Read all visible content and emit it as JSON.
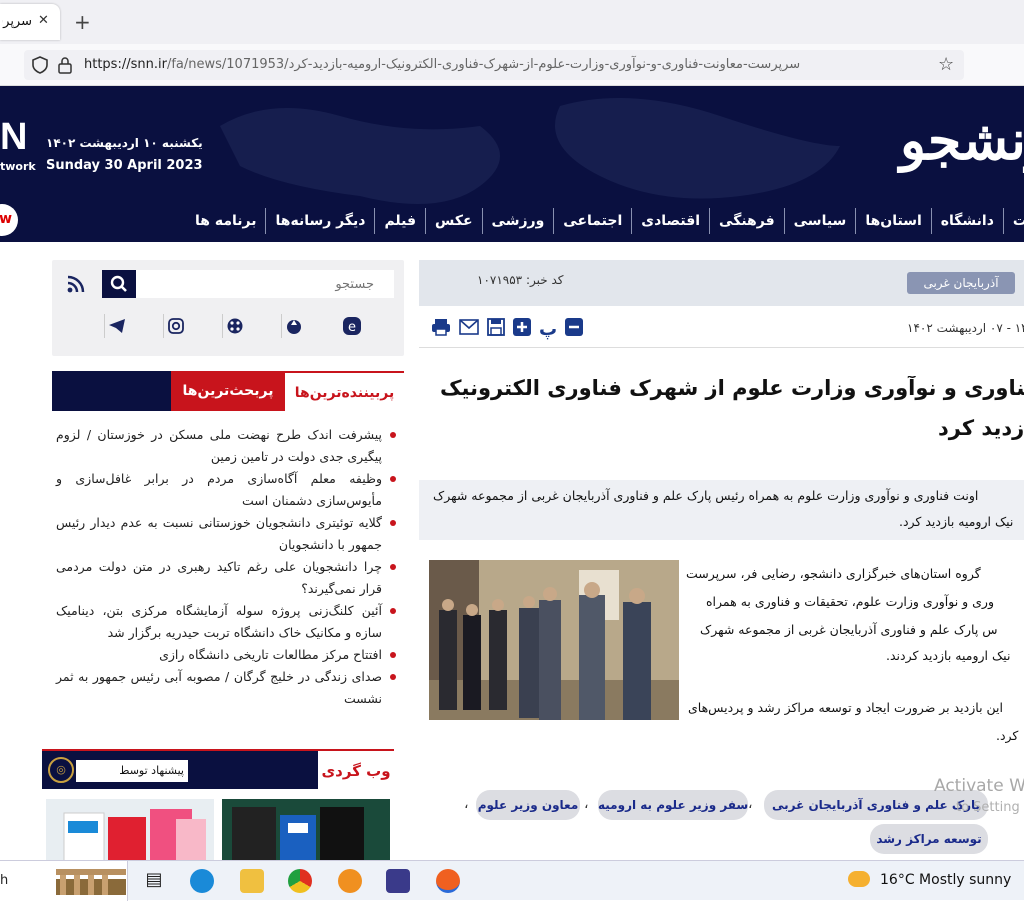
{
  "browser": {
    "tab_title": "سرپرست",
    "url_host": "https://snn.ir",
    "url_path": "/fa/news/1071953/سرپرست-معاونت-فناوری-و-نوآوری-وزارت-علوم-از-شهرک-فناوری-الکترونیک-ارومیه-بازدید-کرد"
  },
  "header": {
    "brand_left": "N",
    "brand_left_sub": "twork",
    "date_fa": "یکشنبه ۱۰ اردیبهشت ۱۴۰۲",
    "date_en": "Sunday 30 April 2023",
    "logo": "رنشجو",
    "live_badge": "w",
    "nav": [
      "ت",
      "دانشگاه",
      "استان‌ها",
      "سیاسی",
      "فرهنگی",
      "اقتصادی",
      "اجتماعی",
      "ورزشی",
      "عکس",
      "فیلم",
      "دیگر رسانه‌ها",
      "برنامه ها"
    ]
  },
  "sidebar": {
    "search_placeholder": "جستجو",
    "tab_active": "پربحث‌ترین‌ها",
    "tab_other": "پربیننده‌ترین‌ها",
    "news": [
      "پیشرفت اندک طرح نهضت ملی مسکن در خوزستان / لزوم پیگیری جدی دولت در تامین زمین",
      "وظیفه معلم آگاه‌سازی مردم در برابر غافل‌سازی و مأیوس‌سازی دشمنان است",
      "گلایه توئیتری دانشجویان خوزستانی نسبت به عدم دیدار رئیس جمهور با دانشجویان",
      "چرا دانشجویان علی رغم تاکید رهبری در متن دولت مردمی قرار نمی‌گیرند؟",
      "آئین کلنگ‌زنی پروژه سوله آزمایشگاه مرکزی بتن، دینامیک سازه و مکانیک خاک دانشگاه تربت حیدریه برگزار شد",
      "افتتاح مرکز مطالعات تاریخی دانشگاه رازی",
      "صدای زندگی در خلیج گرگان / مصوبه آبی رئیس جمهور به ثمر نشست"
    ],
    "webgardi_title": "وب گردی",
    "suggest_label": "پیشنهاد توسط"
  },
  "article": {
    "province": "آذربایجان غربی",
    "news_code": "کد خبر: ۱۰۷۱۹۵۳",
    "pub_date": "۱۴ - ۰۷ اردیبهشت ۱۴۰۲",
    "headline_l1": "ت معاونت فناوری و نوآوری وزارت علوم از شهرک فناوری الکترونیک",
    "headline_l2": "بازدید کرد",
    "lead_l1": "اونت فناوری و نوآوری وزارت علوم به همراه رئیس پارک علم و فناوری آذربایجان غربی از مجموعه شهرک",
    "lead_l2": "نیک ارومیه بازدید کرد.",
    "body_lines": [
      "گروه استان‌های خبرگزاری دانشجو، رضایی فر، سرپرست",
      "وری و نوآوری وزارت علوم، تحقیقات و فناوری به همراه",
      "س پارک علم و فناوری آذربایجان غربی از مجموعه شهرک",
      "نیک ارومیه بازدید کردند.",
      "این بازدید بر ضرورت ایجاد و توسعه مراکز رشد و پردیس‌های",
      "کرد."
    ],
    "tags": [
      "پارک علم و فناوری آذربایجان غربی",
      "سفر وزیر علوم به ارومیه",
      "معاون وزیر علوم",
      "توسعه مراکز رشد"
    ]
  },
  "overlay": {
    "activate": "Activate W",
    "settings": "to Setting"
  },
  "taskbar": {
    "search": "h",
    "temp": "16°C",
    "weather": "Mostly sunny"
  }
}
